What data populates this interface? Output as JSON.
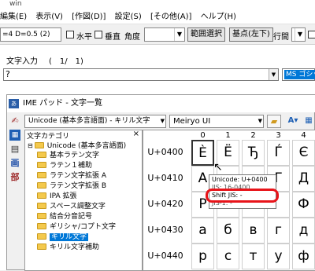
{
  "app": {
    "title_fragment": "win"
  },
  "menu": [
    "編集(E)",
    "表示(V)",
    "[作図(D)]",
    "設定(S)",
    "[その他(A)]",
    "ヘルプ(H)"
  ],
  "toolbar": {
    "dims": "=4  D=0.5 (2)",
    "horizontal": "水平",
    "vertical": "垂直",
    "angle": "角度",
    "range_select": "範囲選択",
    "base_point": "基点(左下)",
    "line_spacing": "行間",
    "vertical_writing": "縦"
  },
  "input_panel": {
    "label": "文字入力",
    "counter": "(　1/　1)",
    "value": "?",
    "font_box": "MS ゴシッ"
  },
  "ime": {
    "title": "IME パッド - 文字一覧",
    "unicode_set": "Unicode (基本多言語面) - キリル文字",
    "font": "Meiryo UI",
    "category_header": "文字カテゴリ",
    "tree": [
      "Unicode (基本多言語面)",
      "基本ラテン文字",
      "ラテン１補助",
      "ラテン文字拡張 A",
      "ラテン文字拡張 B",
      "IPA 拡張",
      "スペース調整文字",
      "結合分音記号",
      "ギリシャ/コプト文字",
      "キリル文字",
      "キリル文字補助"
    ],
    "columns": [
      "0",
      "1",
      "2",
      "3",
      "4"
    ],
    "rows": [
      {
        "label": "U+0400",
        "chars": [
          "È",
          "Ё",
          "Ђ",
          "Ѓ",
          "Є"
        ]
      },
      {
        "label": "U+0410",
        "chars": [
          "А",
          "",
          "",
          "Г",
          "Д"
        ]
      },
      {
        "label": "U+0420",
        "chars": [
          "Р",
          "",
          "",
          "",
          "Ф"
        ]
      },
      {
        "label": "U+0430",
        "chars": [
          "а",
          "б",
          "в",
          "г",
          "д"
        ]
      },
      {
        "label": "U+0440",
        "chars": [
          "р",
          "с",
          "т",
          "у",
          "ф"
        ]
      }
    ],
    "tooltip": {
      "unicode": "Unicode: U+0400",
      "jis": "JIS: 16-0400",
      "shift_jis": "Shift JIS: -",
      "euc": "JIS-1: -"
    },
    "side_icons": [
      "✍",
      "画",
      "部"
    ]
  }
}
